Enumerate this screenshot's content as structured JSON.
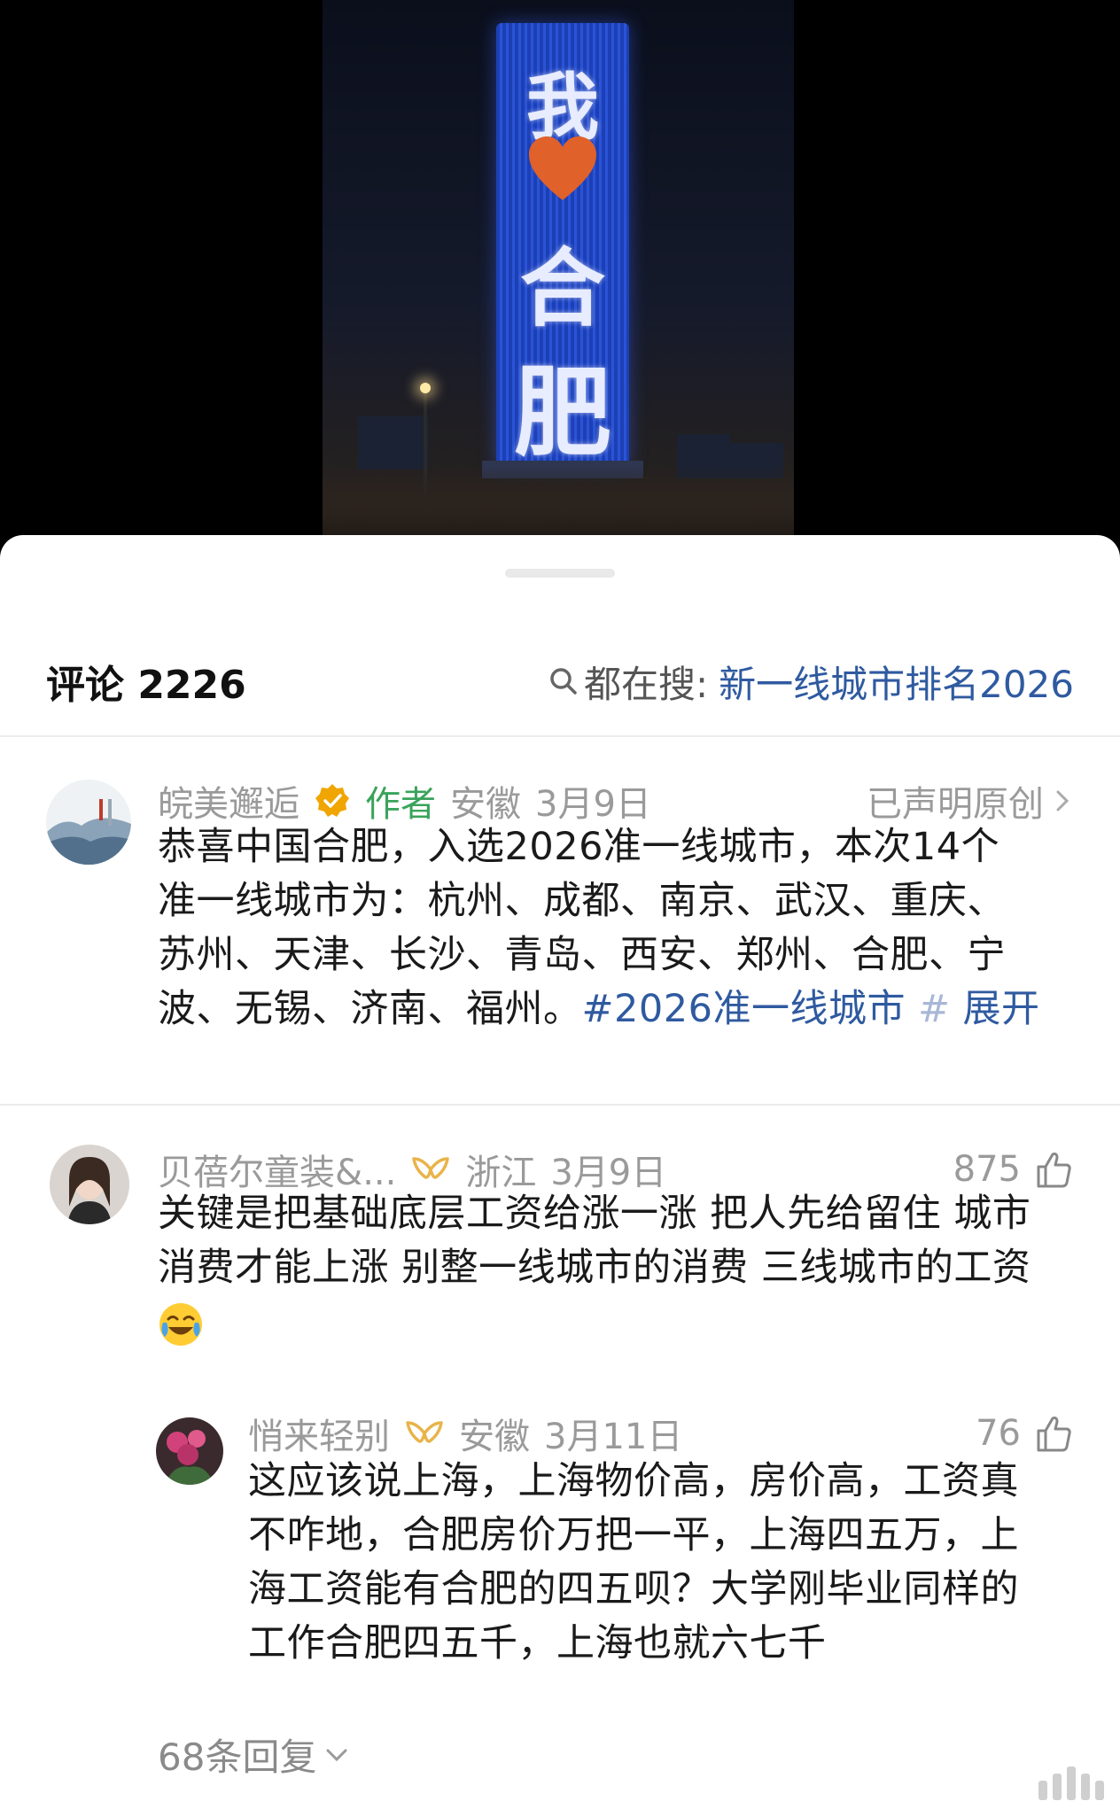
{
  "video": {
    "tower_text_top": "我",
    "tower_text_mid": "合",
    "tower_text_bottom": "肥"
  },
  "header": {
    "title": "评论 2226",
    "hot_search_prefix": "都在搜:",
    "hot_search_query": "新一线城市排名2026"
  },
  "comments": [
    {
      "username": "皖美邂逅",
      "author_tag": "作者",
      "location": "安徽",
      "date": "3月9日",
      "right_label": "已声明原创",
      "lines": [
        "恭喜中国合肥，入选2026准一线城市，本次14个",
        "准一线城市为：杭州、成都、南京、武汉、重庆、",
        "苏州、天津、长沙、青岛、西安、郑州、合肥、宁",
        "波、无锡、济南、福州。"
      ],
      "hashtag": "#2026准一线城市",
      "hash_end": "#",
      "expand": "展开"
    },
    {
      "username": "贝蓓尔童装&...",
      "location": "浙江",
      "date": "3月9日",
      "likes": "875",
      "lines": [
        "关键是把基础底层工资给涨一涨 把人先给留住 城市",
        "消费才能上涨 别整一线城市的消费 三线城市的工资"
      ],
      "replies": [
        {
          "username": "悄来轻别",
          "location": "安徽",
          "date": "3月11日",
          "likes": "76",
          "lines": [
            "这应该说上海，上海物价高，房价高，工资真",
            "不咋地，合肥房价万把一平，上海四五万，上",
            "海工资能有合肥的四五呗？大学刚毕业同样的",
            "工作合肥四五千，上海也就六七千"
          ]
        }
      ],
      "more_replies": "68条回复"
    }
  ],
  "colors": {
    "link": "#2f5aa0",
    "author_green": "#3aa35b",
    "meta_gray": "#9a9a9a",
    "verified_gold": "#f0a500"
  }
}
